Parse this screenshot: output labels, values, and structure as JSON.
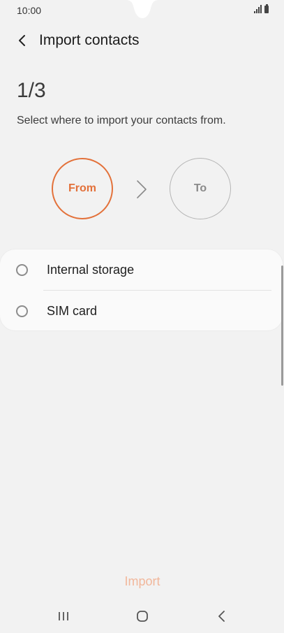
{
  "status_bar": {
    "time": "10:00"
  },
  "header": {
    "title": "Import contacts",
    "back_icon": "chevron-left-icon"
  },
  "step": {
    "counter": "1/3",
    "instruction": "Select where to import your contacts from."
  },
  "flow": {
    "from_label": "From",
    "to_label": "To",
    "accent_color": "#e3713a"
  },
  "options": [
    {
      "label": "Internal storage",
      "selected": false
    },
    {
      "label": "SIM card",
      "selected": false
    }
  ],
  "actions": {
    "import_label": "Import",
    "import_color": "#f1b79b"
  },
  "navigation": {
    "recents_icon": "recents-icon",
    "home_icon": "home-icon",
    "back_icon": "back-icon"
  }
}
